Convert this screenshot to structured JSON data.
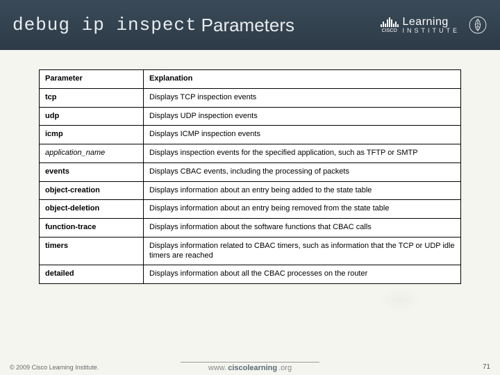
{
  "header": {
    "title_code": "debug ip inspect",
    "title_rest": "Parameters",
    "logo": {
      "brand_small": "CISCO",
      "line1": "Learning",
      "line2": "INSTITUTE"
    }
  },
  "table": {
    "col1": "Parameter",
    "col2": "Explanation",
    "rows": [
      {
        "param": "tcp",
        "italic": false,
        "explain": "Displays TCP inspection events"
      },
      {
        "param": "udp",
        "italic": false,
        "explain": "Displays UDP inspection events"
      },
      {
        "param": "icmp",
        "italic": false,
        "explain": "Displays ICMP inspection events"
      },
      {
        "param": "application_name",
        "italic": true,
        "explain": "Displays inspection events for the specified application, such as TFTP or SMTP"
      },
      {
        "param": "events",
        "italic": false,
        "explain": "Displays CBAC events, including the processing of packets"
      },
      {
        "param": "object-creation",
        "italic": false,
        "explain": "Displays information about an entry being added to the state table"
      },
      {
        "param": "object-deletion",
        "italic": false,
        "explain": "Displays information about an entry being removed from the state table"
      },
      {
        "param": "function-trace",
        "italic": false,
        "explain": "Displays information about the software functions that CBAC calls"
      },
      {
        "param": "timers",
        "italic": false,
        "explain": "Displays information related to CBAC timers, such as information that the TCP or UDP idle timers are reached"
      },
      {
        "param": "detailed",
        "italic": false,
        "explain": "Displays information about all the CBAC processes on the router"
      }
    ]
  },
  "footer": {
    "copyright": "© 2009 Cisco Learning Institute.",
    "url_www": "www.",
    "url_mid": "ciscolearning",
    "url_org": ".org",
    "page": "71"
  }
}
